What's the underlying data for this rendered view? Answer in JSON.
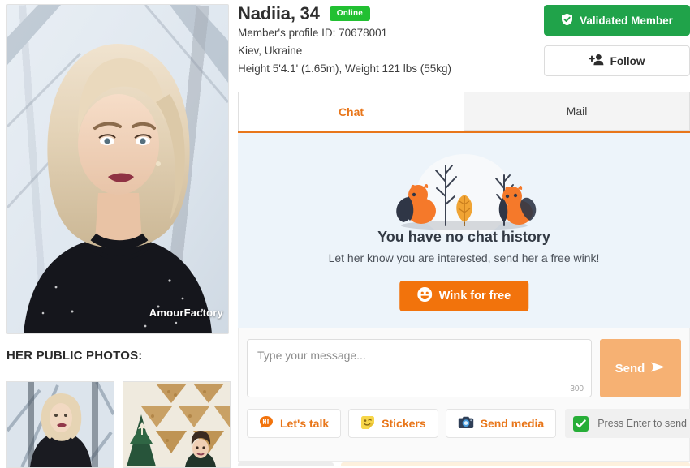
{
  "profile": {
    "name": "Nadiia, 34",
    "status_badge": "Online",
    "member_id_line": "Member's profile ID: 70678001",
    "location": "Kiev, Ukraine",
    "physical": "Height 5'4.1' (1.65m), Weight 121 lbs (55kg)",
    "validated_label": "Validated Member",
    "follow_label": "Follow",
    "watermark": "AmourFactory"
  },
  "photos": {
    "section_title": "HER PUBLIC PHOTOS:",
    "main_alt": "Blonde woman with choker and black sparkly top",
    "thumbs": [
      {
        "alt": "Blonde woman in glass building"
      },
      {
        "alt": "Woman in front of firewood wall with Christmas tree"
      }
    ]
  },
  "tabs": [
    {
      "label": "Chat",
      "active": true
    },
    {
      "label": "Mail",
      "active": false
    }
  ],
  "chat": {
    "empty_title": "You have no chat history",
    "empty_subtitle": "Let her know you are interested, send her a free wink!",
    "wink_label": "Wink for free"
  },
  "composer": {
    "placeholder": "Type your message...",
    "value": "",
    "char_count": "300",
    "send_label": "Send",
    "actions": [
      {
        "label": "Let's talk",
        "icon": "hi-speech-bubble-icon"
      },
      {
        "label": "Stickers",
        "icon": "sticker-icon"
      },
      {
        "label": "Send media",
        "icon": "camera-icon"
      }
    ],
    "enter_to_send_label": "Press Enter to send",
    "enter_to_send_checked": true
  },
  "colors": {
    "accent_orange": "#e8761a",
    "wink_orange": "#f2730c",
    "green": "#20a34a",
    "online_green": "#22c032",
    "chat_bg": "#edf4fa",
    "send_disabled": "#f6b173"
  }
}
